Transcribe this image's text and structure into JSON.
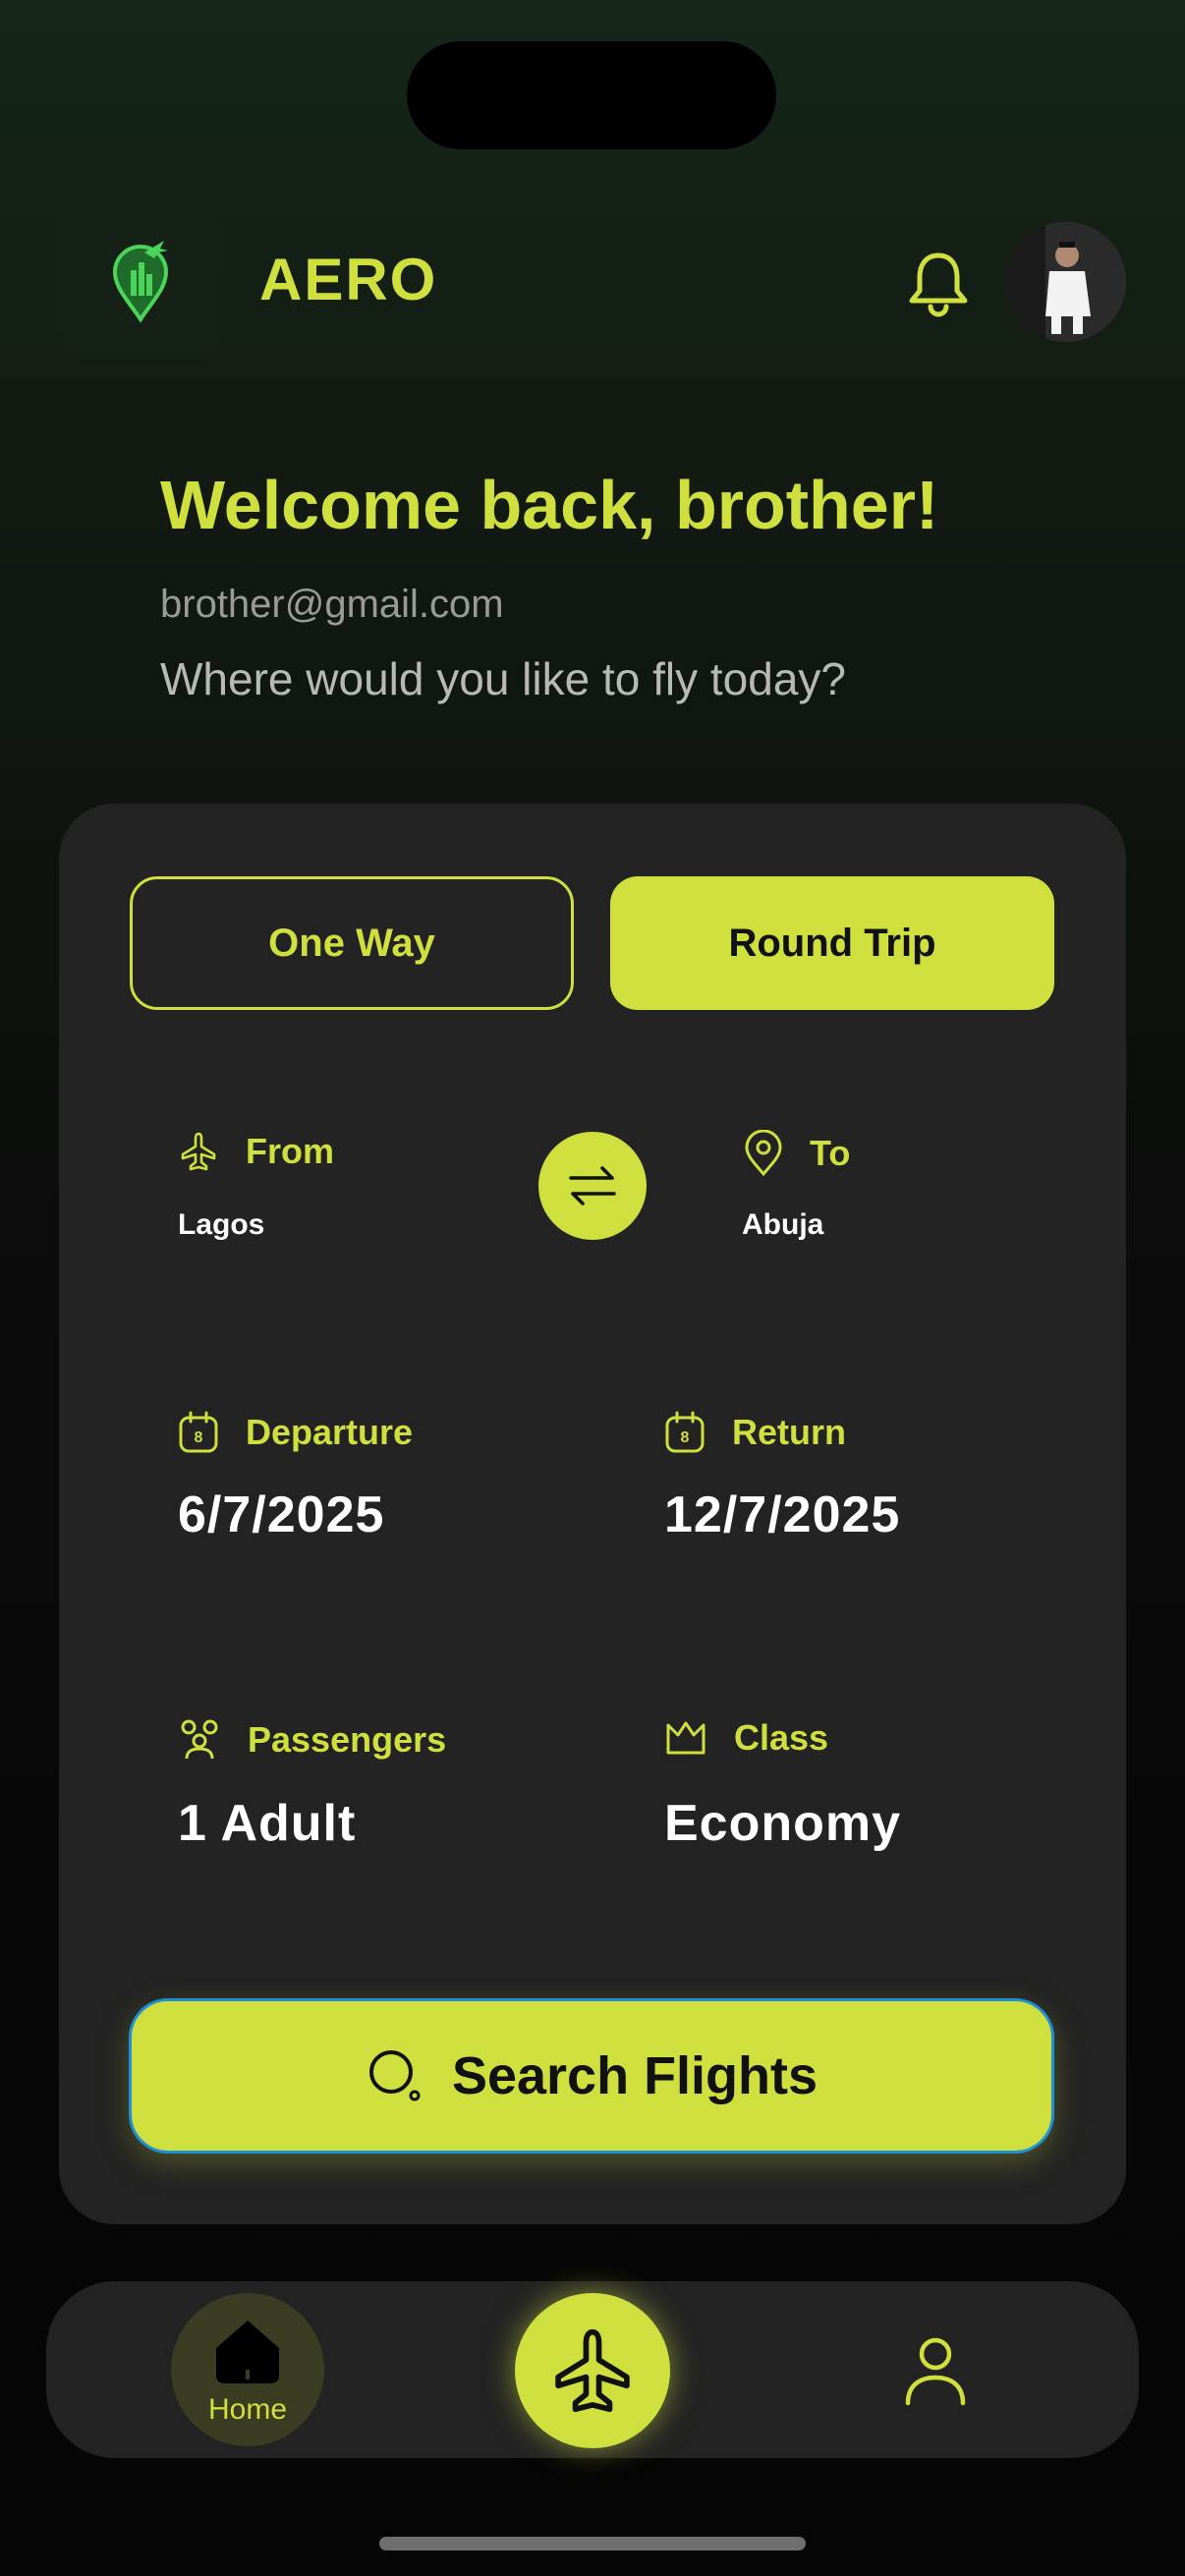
{
  "app": {
    "brand": "AERO"
  },
  "header": {
    "logo_icon": "location-pin-plane-icon",
    "bell_icon": "bell-icon",
    "avatar_icon": "user-avatar"
  },
  "greeting": {
    "title": "Welcome back, brother!",
    "email": "brother@gmail.com",
    "subtitle": "Where would you like to fly today?"
  },
  "trip_type": {
    "one_way": "One Way",
    "round_trip": "Round Trip",
    "selected": "Round Trip"
  },
  "route": {
    "from_label": "From",
    "from_value": "Lagos",
    "to_label": "To",
    "to_value": "Abuja",
    "swap_icon": "swap-arrows-icon"
  },
  "dates": {
    "departure_label": "Departure",
    "departure_value": "6/7/2025",
    "return_label": "Return",
    "return_value": "12/7/2025",
    "calendar_icon_text": "8"
  },
  "details": {
    "passengers_label": "Passengers",
    "passengers_value": "1 Adult",
    "class_label": "Class",
    "class_value": "Economy"
  },
  "search_button": {
    "label": "Search Flights",
    "icon": "search-icon"
  },
  "bottom_nav": {
    "home_label": "Home",
    "flights_icon": "airplane-icon",
    "profile_icon": "user-icon"
  },
  "colors": {
    "accent": "#cfdf3d",
    "card": "#232323",
    "background": "#0b0b0b"
  }
}
